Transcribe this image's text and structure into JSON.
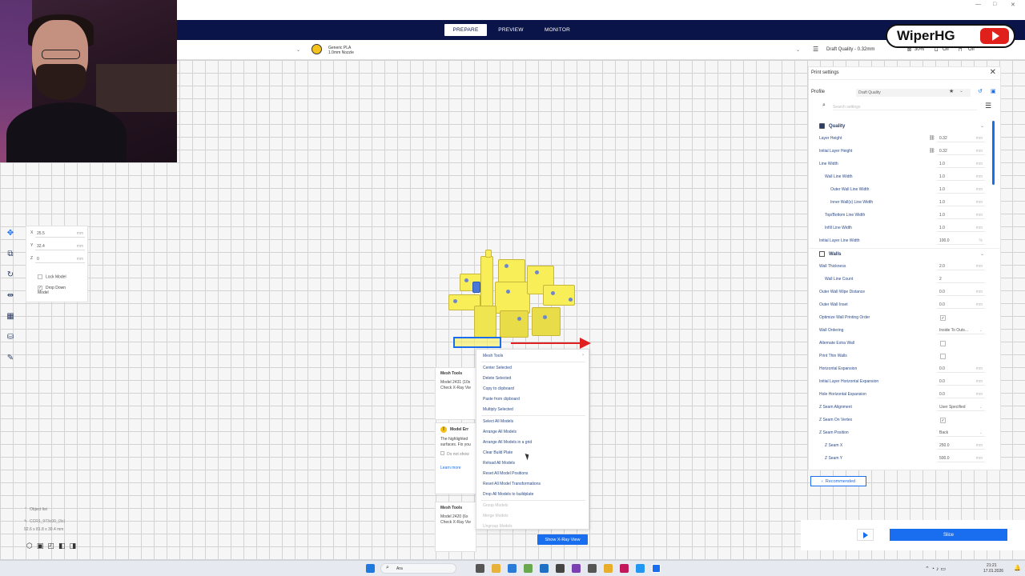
{
  "window": {
    "min": "—",
    "max": "□",
    "close": "✕"
  },
  "stages": {
    "prepare": "PREPARE",
    "preview": "PREVIEW",
    "monitor": "MONITOR"
  },
  "logo": {
    "text": "WiperHG"
  },
  "printer": {
    "material_line1": "Generic PLA",
    "material_line2": "1.0mm Nozzle",
    "profile_summary": "Draft Quality - 0.32mm",
    "infill": "30%",
    "support": "Off",
    "adhesion": "Off"
  },
  "move_panel": {
    "x": {
      "axis": "X",
      "value": "25.5",
      "unit": "mm"
    },
    "y": {
      "axis": "Y",
      "value": "32.4",
      "unit": "mm"
    },
    "z": {
      "axis": "Z",
      "value": "0",
      "unit": "mm"
    },
    "lock_model": "Lock Model",
    "drop_down": "Drop Down Model"
  },
  "messages": {
    "mesh1_title": "Mesh Tools",
    "mesh1_body": "Model 2431 (10x",
    "mesh1_body2": "Check X-Ray Vie",
    "error_title": "Model Err",
    "error_body": "The highlighted",
    "error_body2": "surfaces. Fix you",
    "do_not_show": "Do not show",
    "learn_more": "Learn more",
    "mesh2_title": "Mesh Tools",
    "mesh2_body": "Model 2420 (6x",
    "mesh2_body2": "Check X-Ray Vie",
    "xray_button": "Show X-Ray View"
  },
  "context_menu": {
    "items": [
      {
        "label": "Mesh Tools",
        "disabled": false
      },
      {
        "label": "Center Selected",
        "disabled": false
      },
      {
        "label": "Delete Selected",
        "disabled": false
      },
      {
        "label": "Copy to clipboard",
        "disabled": false
      },
      {
        "label": "Paste from clipboard",
        "disabled": false
      },
      {
        "label": "Multiply Selected",
        "disabled": false
      },
      {
        "label": "Select All Models",
        "disabled": false
      },
      {
        "label": "Arrange All Models",
        "disabled": false
      },
      {
        "label": "Arrange All Models in a grid",
        "disabled": false
      },
      {
        "label": "Clear Build Plate",
        "disabled": false
      },
      {
        "label": "Reload All Models",
        "disabled": false
      },
      {
        "label": "Reset All Model Positions",
        "disabled": false
      },
      {
        "label": "Reset All Model Transformations",
        "disabled": false
      },
      {
        "label": "Drop All Models to buildplate",
        "disabled": false
      },
      {
        "label": "Group Models",
        "disabled": true
      },
      {
        "label": "Merge Models",
        "disabled": true
      },
      {
        "label": "Ungroup Models",
        "disabled": true
      }
    ]
  },
  "object_list": {
    "header": "Object list",
    "name": "CCR1_973c00_(3x)",
    "dims": "92.6 x 81.8 x 30.4 mm"
  },
  "print_settings": {
    "title": "Print settings",
    "profile_label": "Profile",
    "profile_value": "Draft Quality",
    "search_placeholder": "Search settings",
    "quality_header": "Quality",
    "walls_header": "Walls",
    "quality_rows": [
      {
        "label": "Layer Height",
        "value": "0.32",
        "unit": "mm",
        "indent": 0,
        "link": true
      },
      {
        "label": "Initial Layer Height",
        "value": "0.32",
        "unit": "mm",
        "indent": 0,
        "link": true
      },
      {
        "label": "Line Width",
        "value": "1.0",
        "unit": "mm",
        "indent": 0
      },
      {
        "label": "Wall Line Width",
        "value": "1.0",
        "unit": "mm",
        "indent": 1
      },
      {
        "label": "Outer Wall Line Width",
        "value": "1.0",
        "unit": "mm",
        "indent": 2
      },
      {
        "label": "Inner Wall(s) Line Width",
        "value": "1.0",
        "unit": "mm",
        "indent": 2
      },
      {
        "label": "Top/Bottom Line Width",
        "value": "1.0",
        "unit": "mm",
        "indent": 1
      },
      {
        "label": "Infill Line Width",
        "value": "1.0",
        "unit": "mm",
        "indent": 1
      },
      {
        "label": "Initial Layer Line Width",
        "value": "100.0",
        "unit": "%",
        "indent": 0
      }
    ],
    "walls_rows": [
      {
        "label": "Wall Thickness",
        "value": "2.0",
        "unit": "mm",
        "indent": 0
      },
      {
        "label": "Wall Line Count",
        "value": "2",
        "unit": "",
        "indent": 1
      },
      {
        "label": "Outer Wall Wipe Distance",
        "value": "0.0",
        "unit": "mm",
        "indent": 0
      },
      {
        "label": "Outer Wall Inset",
        "value": "0.0",
        "unit": "mm",
        "indent": 0
      },
      {
        "label": "Optimize Wall Printing Order",
        "value": "✓",
        "unit": "",
        "indent": 0,
        "check": true
      },
      {
        "label": "Wall Ordering",
        "value": "Inside To Outs...",
        "unit": "",
        "indent": 0,
        "select": true
      },
      {
        "label": "Alternate Extra Wall",
        "value": "",
        "unit": "",
        "indent": 0,
        "check": true
      },
      {
        "label": "Print Thin Walls",
        "value": "",
        "unit": "",
        "indent": 0,
        "check": true
      },
      {
        "label": "Horizontal Expansion",
        "value": "0.0",
        "unit": "mm",
        "indent": 0
      },
      {
        "label": "Initial Layer Horizontal Expansion",
        "value": "0.0",
        "unit": "mm",
        "indent": 0
      },
      {
        "label": "Hole Horizontal Expansion",
        "value": "0.0",
        "unit": "mm",
        "indent": 0
      },
      {
        "label": "Z Seam Alignment",
        "value": "User Specified",
        "unit": "",
        "indent": 0,
        "select": true
      },
      {
        "label": "Z Seam On Vertex",
        "value": "✓",
        "unit": "",
        "indent": 0,
        "check": true
      },
      {
        "label": "Z Seam Position",
        "value": "Back",
        "unit": "",
        "indent": 0,
        "select": true
      },
      {
        "label": "Z Seam X",
        "value": "250.0",
        "unit": "mm",
        "indent": 1
      },
      {
        "label": "Z Seam Y",
        "value": "500.0",
        "unit": "mm",
        "indent": 1
      }
    ],
    "recommended_button": "Recommended"
  },
  "slice": {
    "button": "Slice"
  },
  "taskbar": {
    "search": "Ara",
    "time": "21:21",
    "date": "17.01.2026"
  }
}
